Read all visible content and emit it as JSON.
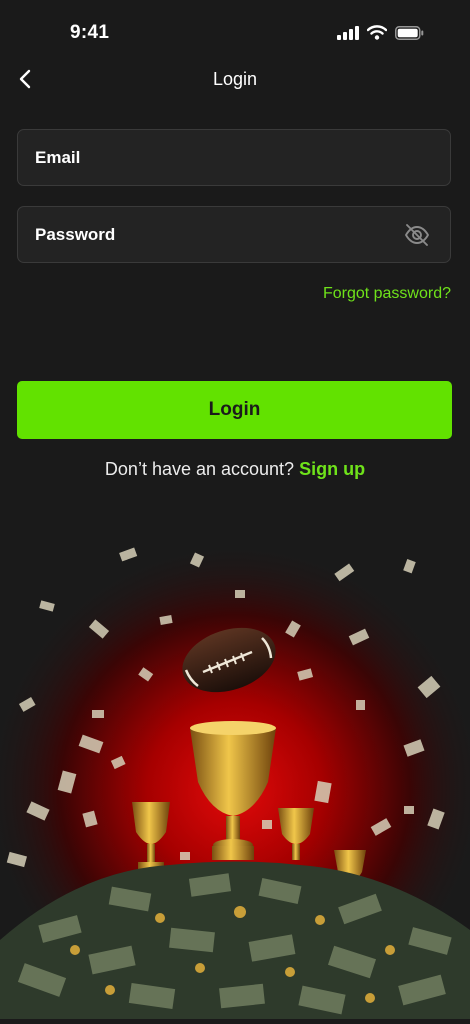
{
  "status_bar": {
    "time": "9:41",
    "icons": [
      "signal-icon",
      "wifi-icon",
      "battery-icon"
    ]
  },
  "nav": {
    "title": "Login",
    "back_icon": "chevron-left-icon"
  },
  "form": {
    "email": {
      "placeholder": "Email",
      "value": ""
    },
    "password": {
      "placeholder": "Password",
      "value": "",
      "toggle_icon": "eye-off-icon"
    },
    "forgot_label": "Forgot password?",
    "login_label": "Login"
  },
  "signup": {
    "prompt": "Don’t have an account?",
    "link_label": "Sign up"
  },
  "hero": {
    "description_icon": "trophy-football-money-illustration"
  },
  "colors": {
    "background": "#1a1a1a",
    "field_bg": "#232323",
    "field_border": "#3a3a3a",
    "accent": "#62e200",
    "accent_text": "#6fe21a",
    "hero_glow": "#c40000"
  }
}
